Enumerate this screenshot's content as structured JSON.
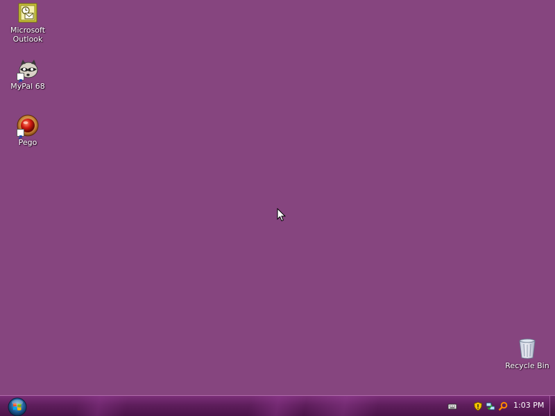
{
  "desktop": {
    "background_color": "#86457f",
    "icons": [
      {
        "label": "Microsoft\nOutlook",
        "icon": "outlook-icon",
        "shortcut": false
      },
      {
        "label": "MyPal 68",
        "icon": "mypal-raccoon-icon",
        "shortcut": true
      },
      {
        "label": "Pego",
        "icon": "pego-red-orb-icon",
        "shortcut": true
      },
      {
        "label": "Recycle Bin",
        "icon": "recycle-bin-icon",
        "shortcut": false
      }
    ]
  },
  "taskbar": {
    "start_icon": "windows-start-orb-icon",
    "tray_icons": [
      "keyboard-icon",
      "security-shield-icon",
      "network-icon",
      "search-icon"
    ],
    "clock": "1:03 PM"
  }
}
